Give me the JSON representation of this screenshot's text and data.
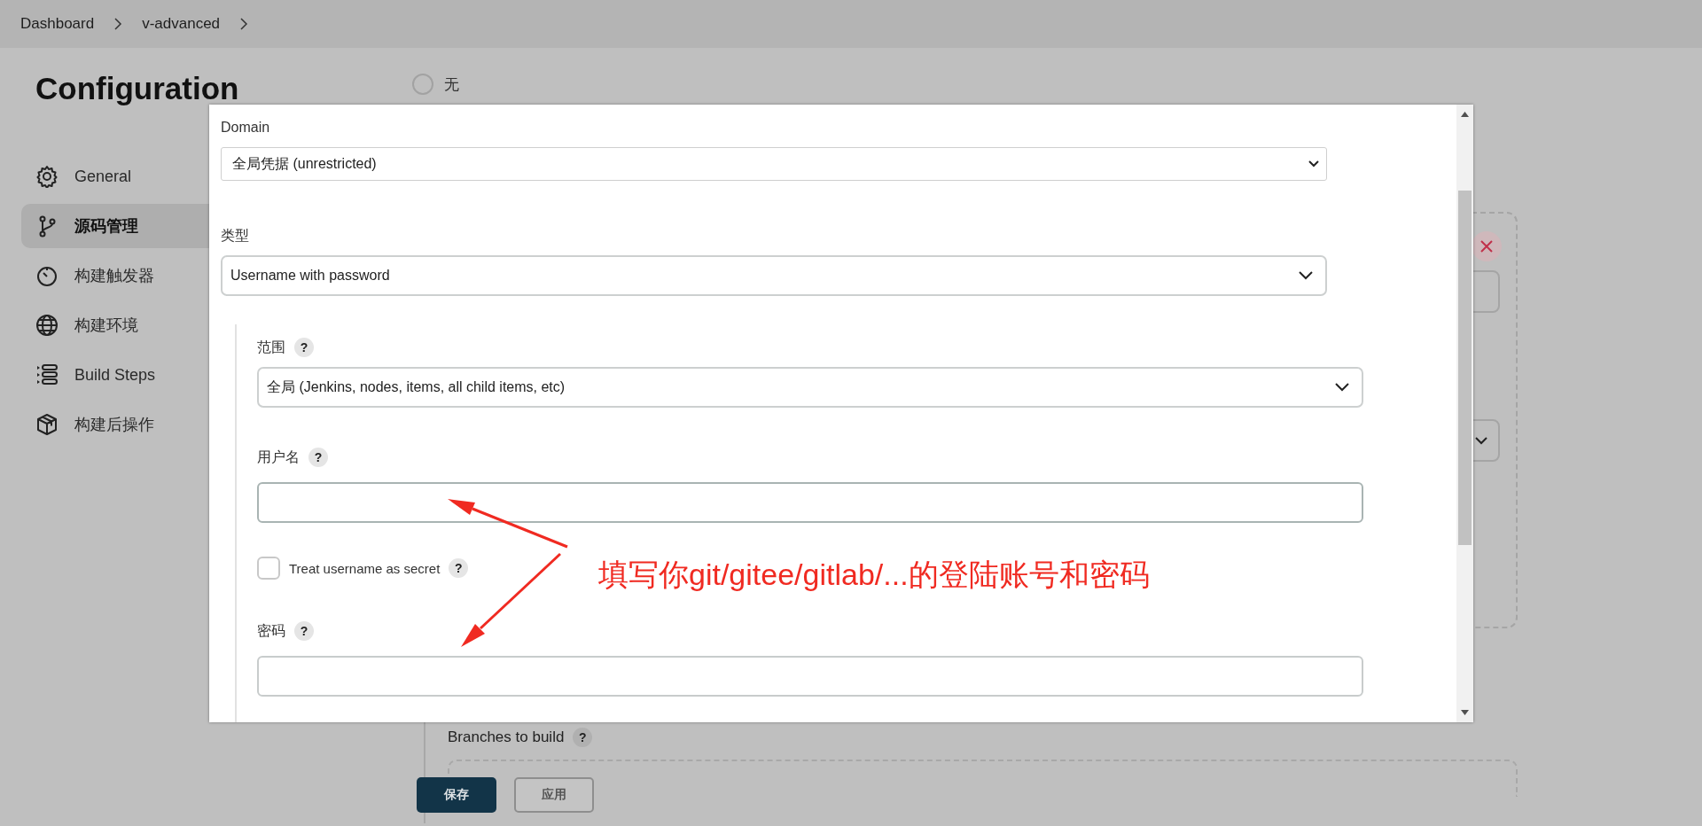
{
  "breadcrumb": [
    {
      "label": "Dashboard"
    },
    {
      "label": "v-advanced"
    }
  ],
  "page_title": "Configuration",
  "sidebar": {
    "items": [
      {
        "label": "General",
        "selected": false
      },
      {
        "label": "源码管理",
        "selected": true
      },
      {
        "label": "构建触发器",
        "selected": false
      },
      {
        "label": "构建环境",
        "selected": false
      },
      {
        "label": "Build Steps",
        "selected": false
      },
      {
        "label": "构建后操作",
        "selected": false
      }
    ]
  },
  "source_option": {
    "label": "无",
    "selected": false
  },
  "branches": {
    "label": "Branches to build",
    "help": "?"
  },
  "buttons": [
    {
      "label": "保存",
      "kind": "primary"
    },
    {
      "label": "应用",
      "kind": "secondary"
    }
  ],
  "dialog": {
    "domain": {
      "label": "Domain",
      "value": "全局凭据 (unrestricted)"
    },
    "type": {
      "label": "类型",
      "value": "Username with password"
    },
    "scope": {
      "label": "范围",
      "help": "?",
      "value": "全局 (Jenkins, nodes, items, all child items, etc)"
    },
    "username": {
      "label": "用户名",
      "help": "?"
    },
    "treat_secret": {
      "label": "Treat username as secret",
      "help": "?",
      "checked": false
    },
    "password": {
      "label": "密码",
      "help": "?"
    }
  },
  "annotation": {
    "text": "填写你git/gitee/gitlab/...的登陆账号和密码"
  }
}
